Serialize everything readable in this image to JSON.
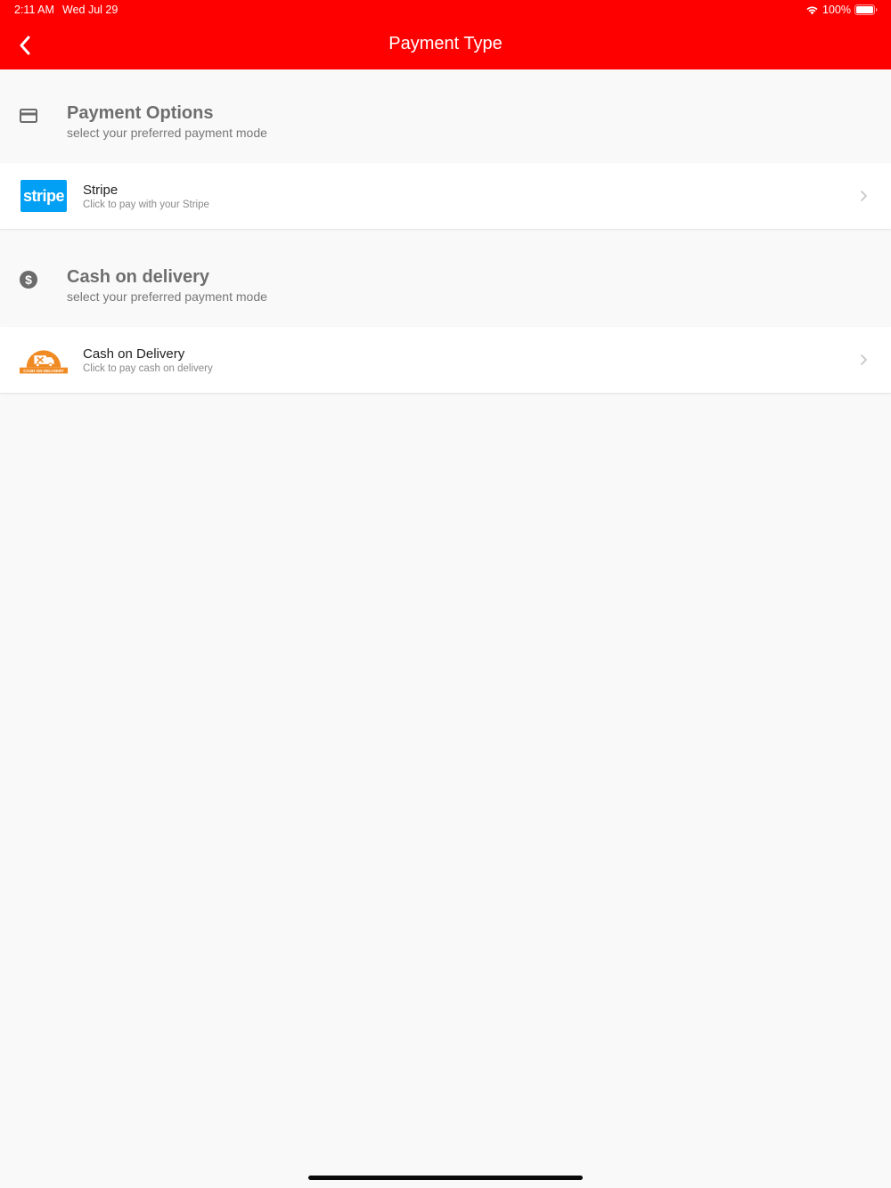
{
  "status_bar": {
    "time": "2:11 AM",
    "date": "Wed Jul 29",
    "battery_percent": "100%",
    "wifi_icon": "wifi-icon",
    "battery_icon": "battery-full-icon"
  },
  "header": {
    "title": "Payment Type",
    "back_icon": "chevron-left-icon",
    "background_color": "#fe0000"
  },
  "sections": [
    {
      "icon": "credit-card-icon",
      "title": "Payment Options",
      "subtitle": "select your preferred payment mode",
      "option": {
        "logo": "stripe-logo",
        "logo_text": "stripe",
        "title": "Stripe",
        "subtitle": "Click to pay with your Stripe",
        "chevron_icon": "chevron-right-icon"
      }
    },
    {
      "icon": "dollar-circle-icon",
      "title": "Cash on delivery",
      "subtitle": "select your preferred payment mode",
      "option": {
        "logo": "cash-on-delivery-logo",
        "logo_text": "CASH ON DELIVERY",
        "title": "Cash on Delivery",
        "subtitle": "Click to pay cash on delivery",
        "chevron_icon": "chevron-right-icon"
      }
    }
  ],
  "colors": {
    "accent": "#fe0000",
    "stripe_blue": "#01a0f4",
    "cod_orange": "#f08a23",
    "background": "#f9f9f9"
  }
}
